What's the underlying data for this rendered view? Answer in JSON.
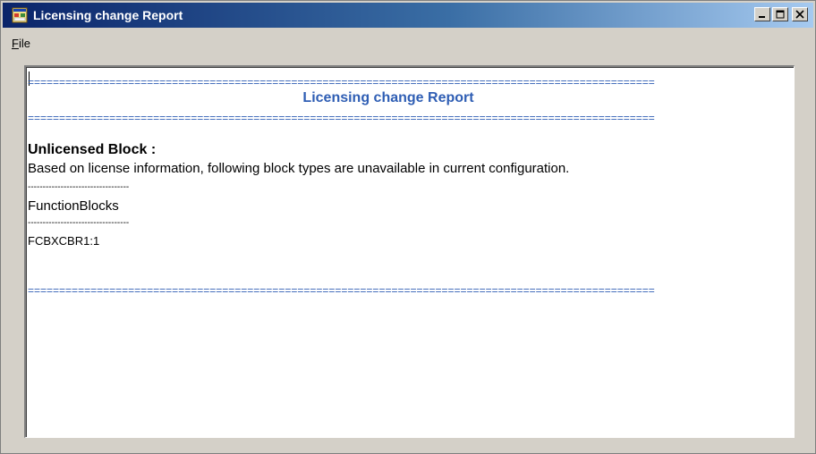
{
  "window": {
    "title": "Licensing change Report",
    "title_bar_color": "#0a246a"
  },
  "menu": {
    "file_mnemonic": "F",
    "file_rest": "ile"
  },
  "report": {
    "separator": "====================================================================================================",
    "title": "Licensing change Report",
    "accent_color": "#2f5eb4",
    "section_heading": "Unlicensed Block :",
    "section_description": "Based on license information, following block types are unavailable in current configuration.",
    "dashes": "----------------------------------",
    "group_name": "FunctionBlocks",
    "items": [
      "FCBXCBR1:1"
    ]
  },
  "icons": {
    "app": "app-window-icon",
    "minimize": "minimize-icon",
    "maximize": "maximize-icon",
    "close": "close-icon"
  }
}
